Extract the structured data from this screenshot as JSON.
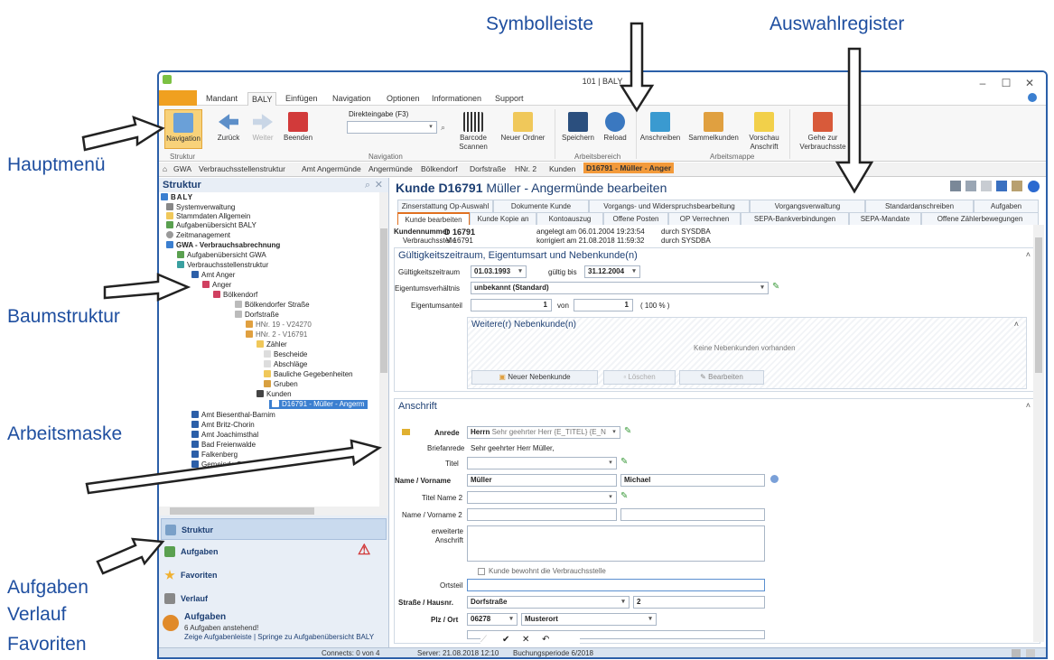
{
  "annotations": {
    "symbolleiste": "Symbolleiste",
    "auswahlregister": "Auswahlregister",
    "hauptmenue": "Hauptmenü",
    "baumstruktur": "Baumstruktur",
    "arbeitsmaske": "Arbeitsmaske",
    "aufgaben": "Aufgaben",
    "verlauf": "Verlauf",
    "favoriten": "Favoriten"
  },
  "window": {
    "title": "101 | BALY"
  },
  "menu": {
    "tabs": [
      "Mandant",
      "BALY",
      "Einfügen",
      "Navigation",
      "Optionen",
      "Informationen",
      "Support"
    ],
    "active": "BALY"
  },
  "ribbon": {
    "navigation": "Navigation",
    "zurueck": "Zurück",
    "weiter": "Weiter",
    "beenden": "Beenden",
    "direkteingabe": "Direkteingabe (F3)",
    "barcode": "Barcode Scannen",
    "neuer_ordner": "Neuer Ordner",
    "speichern": "Speichern",
    "reload": "Reload",
    "anschreiben": "Anschreiben",
    "sammelkunden": "Sammelkunden",
    "vorschau": "Vorschau Anschrift",
    "gehe_zur": "Gehe zur Verbrauchsste",
    "groups": {
      "struktur": "Struktur",
      "navigation": "Navigation",
      "arbeitsbereich": "Arbeitsbereich",
      "arbeitsmappe": "Arbeitsmappe"
    }
  },
  "breadcrumb": [
    "GWA",
    "Verbrauchsstellenstruktur",
    "Amt Angermünde",
    "Angermünde",
    "Bölkendorf",
    "Dorfstraße",
    "HNr. 2",
    "Kunden",
    "D16791 - Müller - Anger"
  ],
  "left": {
    "title": "Struktur",
    "tree": [
      "BALY",
      "Systemverwaltung",
      "Stammdaten Allgemein",
      "Aufgabenübersicht BALY",
      "Zeitmanagement",
      "GWA - Verbrauchsabrechnung",
      "Aufgabenübersicht GWA",
      "Verbrauchsstellenstruktur",
      "Amt Anger",
      "Anger",
      "Bölkendorf",
      "Bölkendorfer Straße",
      "Dorfstraße",
      "HNr. 19 - V24270",
      "HNr. 2 - V16791",
      "Zähler",
      "Bescheide",
      "Abschläge",
      "Bauliche Gegebenheiten",
      "Gruben",
      "Kunden",
      "D16791 - Müller - Angerm",
      "Amt Biesenthal-Barnim",
      "Amt Britz-Chorin",
      "Amt Joachimsthal",
      "Bad Freienwalde",
      "Falkenberg",
      "Gemeinde Schorfheide"
    ],
    "nav": {
      "struktur": "Struktur",
      "aufgaben": "Aufgaben",
      "favoriten": "Favoriten",
      "verlauf": "Verlauf"
    },
    "aufgaben_title": "Aufgaben",
    "aufgaben_text": "6 Aufgaben anstehend!",
    "aufgaben_links": "Zeige Aufgabenleiste  |  Springe zu Aufgabenübersicht BALY"
  },
  "main": {
    "title_bold": "Kunde D16791",
    "title_rest": "Müller - Angermünde bearbeiten",
    "tabs_row1": [
      "Zinserstattung Op-Auswahl",
      "Dokumente Kunde",
      "Vorgangs- und Widerspruchsbearbeitung",
      "Vorgangsverwaltung",
      "Standardanschreiben",
      "Aufgaben"
    ],
    "tabs_row2": [
      "Kunde bearbeiten",
      "Kunde Kopie an",
      "Kontoauszug",
      "Offene Posten",
      "OP Verrechnen",
      "SEPA-Bankverbindungen",
      "SEPA-Mandate",
      "Offene Zählerbewegungen"
    ],
    "kundennummer_label": "Kundennummer",
    "kundennummer": "D 16791",
    "verbrauchsstelle_label": "Verbrauchsstelle",
    "verbrauchsstelle": "V 16791",
    "angelegt": "angelegt am 06.01.2004 19:23:54",
    "korrigiert": "korrigiert am 21.08.2018 11:59:32",
    "durch1": "durch SYSDBA",
    "durch2": "durch SYSDBA",
    "sect1": "Gültigkeitszeitraum, Eigentumsart und Nebenkunde(n)",
    "gz_label": "Gültigkeitszeitraum",
    "gz_from": "01.03.1993",
    "gueltig_bis_label": "gültig bis",
    "gz_to": "31.12.2004",
    "ev_label": "Eigentumsverhältnis",
    "ev": "unbekannt (Standard)",
    "ea_label": "Eigentumsanteil",
    "ea1": "1",
    "von": "von",
    "ea2": "1",
    "ea_pct": "( 100 % )",
    "neben_title": "Weitere(r) Nebenkunde(n)",
    "neben_empty": "Keine Nebenkunden vorhanden",
    "btn_neu": "Neuer Nebenkunde",
    "btn_loeschen": "Löschen",
    "btn_bearbeiten": "Bearbeiten",
    "sect2": "Anschrift",
    "anrede_label": "Anrede",
    "anrede_val": "Herrn",
    "anrede_hint": "Sehr geehrter Herr {E_TITEL} {E_N",
    "briefanrede_label": "Briefanrede",
    "briefanrede": "Sehr geehrter Herr  Müller,",
    "titel_label": "Titel",
    "name_label": "Name / Vorname",
    "name": "Müller",
    "vorname": "Michael",
    "titel2_label": "Titel Name 2",
    "name2_label": "Name / Vorname 2",
    "erw_label": "erweiterte Anschrift",
    "bewohnt": "Kunde bewohnt die Verbrauchsstelle",
    "ortsteil_label": "Ortsteil",
    "strasse_label": "Straße / Hausnr.",
    "strasse": "Dorfstraße",
    "hausnr": "2",
    "plz_label": "Plz / Ort",
    "plz": "06278",
    "ort": "Musterort"
  },
  "status": {
    "connects": "Connects: 0 von 4",
    "server": "Server: 21.08.2018 12:10",
    "buchung": "Buchungsperiode 6/2018"
  },
  "colors": {
    "accent": "#e07020",
    "brand": "#1d3f73",
    "callout": "#1f4fa0"
  }
}
